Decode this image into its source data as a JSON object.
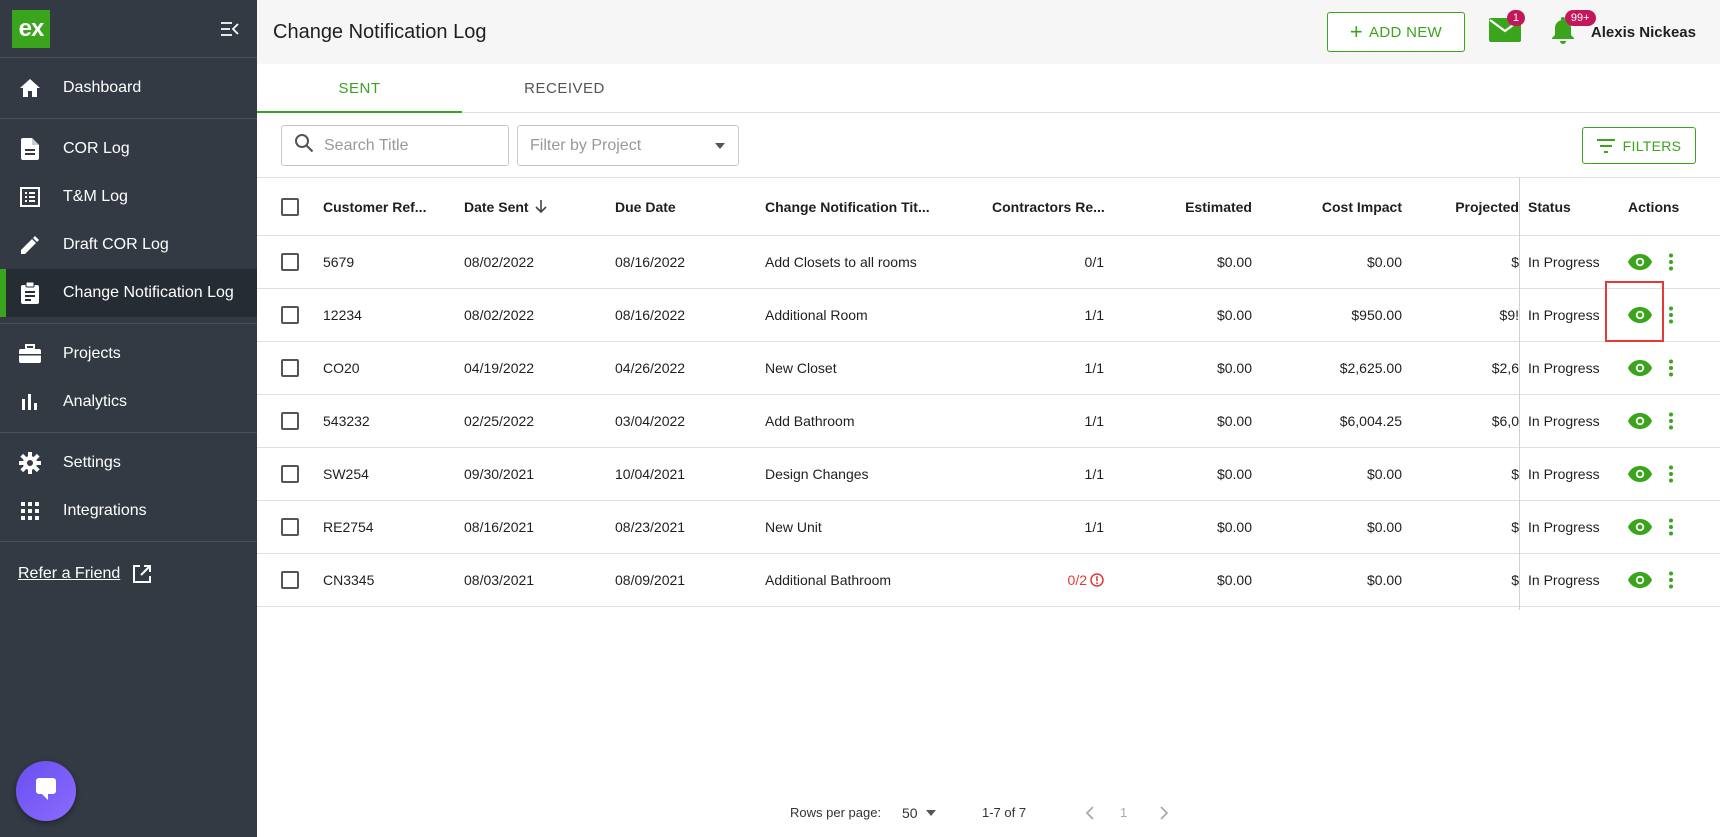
{
  "sidebar": {
    "logo_text": "ex",
    "nav_groups": [
      [
        {
          "label": "Dashboard",
          "icon": "home-icon"
        }
      ],
      [
        {
          "label": "COR Log",
          "icon": "document-icon"
        },
        {
          "label": "T&M Log",
          "icon": "list-icon"
        },
        {
          "label": "Draft COR Log",
          "icon": "pencil-icon"
        },
        {
          "label": "Change Notification Log",
          "icon": "clipboard-icon",
          "active": true
        }
      ],
      [
        {
          "label": "Projects",
          "icon": "briefcase-icon"
        },
        {
          "label": "Analytics",
          "icon": "bar-chart-icon"
        }
      ],
      [
        {
          "label": "Settings",
          "icon": "gear-icon"
        },
        {
          "label": "Integrations",
          "icon": "grid-icon"
        }
      ]
    ],
    "refer_label": "Refer a Friend"
  },
  "header": {
    "title": "Change Notification Log",
    "add_new_label": "ADD NEW",
    "mail_badge": "1",
    "bell_badge": "99+",
    "user_name": "Alexis Nickeas"
  },
  "tabs": [
    {
      "label": "SENT",
      "active": true
    },
    {
      "label": "RECEIVED",
      "active": false
    }
  ],
  "toolbar": {
    "search_placeholder": "Search Title",
    "project_placeholder": "Filter by Project",
    "filters_label": "FILTERS"
  },
  "table": {
    "headers": {
      "ref": "Customer Ref...",
      "date_sent": "Date Sent",
      "due_date": "Due Date",
      "title": "Change Notification Tit...",
      "contractors": "Contractors Re...",
      "estimated": "Estimated",
      "cost_impact": "Cost Impact",
      "projected": "Projected",
      "status": "Status",
      "actions": "Actions"
    },
    "rows": [
      {
        "ref": "5679",
        "date_sent": "08/02/2022",
        "due_date": "08/16/2022",
        "title": "Add Closets to all rooms",
        "contractors": "0/1",
        "estimated": "$0.00",
        "cost_impact": "$0.00",
        "projected": "$",
        "status": "In Progress",
        "warning": false
      },
      {
        "ref": "12234",
        "date_sent": "08/02/2022",
        "due_date": "08/16/2022",
        "title": "Additional Room",
        "contractors": "1/1",
        "estimated": "$0.00",
        "cost_impact": "$950.00",
        "projected": "$9!",
        "status": "In Progress",
        "warning": false
      },
      {
        "ref": "CO20",
        "date_sent": "04/19/2022",
        "due_date": "04/26/2022",
        "title": "New Closet",
        "contractors": "1/1",
        "estimated": "$0.00",
        "cost_impact": "$2,625.00",
        "projected": "$2,6",
        "status": "In Progress",
        "warning": false
      },
      {
        "ref": "543232",
        "date_sent": "02/25/2022",
        "due_date": "03/04/2022",
        "title": "Add Bathroom",
        "contractors": "1/1",
        "estimated": "$0.00",
        "cost_impact": "$6,004.25",
        "projected": "$6,0",
        "status": "In Progress",
        "warning": false
      },
      {
        "ref": "SW254",
        "date_sent": "09/30/2021",
        "due_date": "10/04/2021",
        "title": "Design Changes",
        "contractors": "1/1",
        "estimated": "$0.00",
        "cost_impact": "$0.00",
        "projected": "$",
        "status": "In Progress",
        "warning": false
      },
      {
        "ref": "RE2754",
        "date_sent": "08/16/2021",
        "due_date": "08/23/2021",
        "title": "New Unit",
        "contractors": "1/1",
        "estimated": "$0.00",
        "cost_impact": "$0.00",
        "projected": "$",
        "status": "In Progress",
        "warning": false
      },
      {
        "ref": "CN3345",
        "date_sent": "08/03/2021",
        "due_date": "08/09/2021",
        "title": "Additional Bathroom",
        "contractors": "0/2",
        "estimated": "$0.00",
        "cost_impact": "$0.00",
        "projected": "$",
        "status": "In Progress",
        "warning": true
      }
    ]
  },
  "pagination": {
    "rows_per_page_label": "Rows per page:",
    "rows_per_page": "50",
    "range": "1-7 of 7",
    "page": "1"
  },
  "colors": {
    "accent": "#3aa41c",
    "sidebar": "#333a44",
    "badge": "#c2185b",
    "warning": "#e53935"
  }
}
